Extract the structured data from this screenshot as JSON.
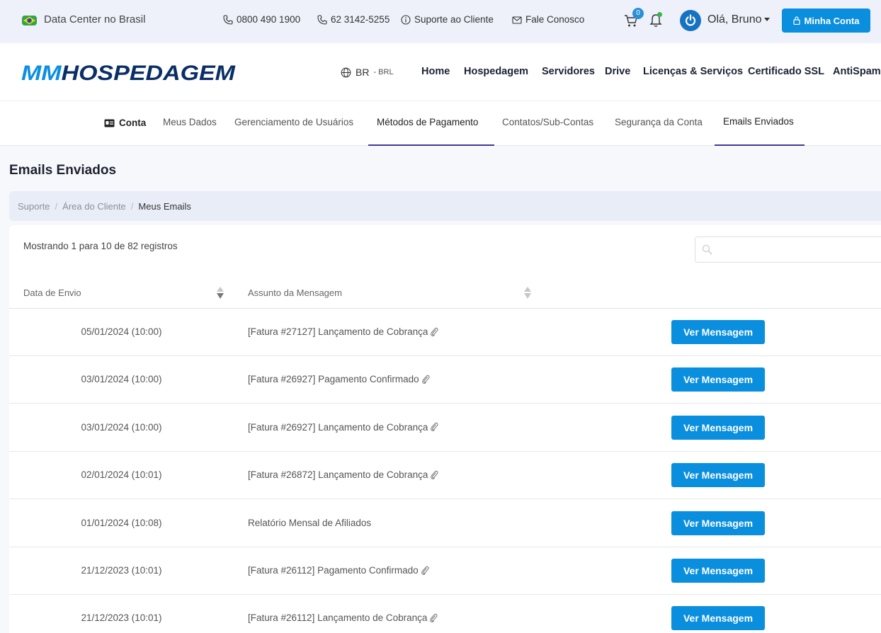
{
  "topbar": {
    "datacenter": "Data Center no Brasil",
    "phone1": "0800 490 1900",
    "phone2": "62 3142-5255",
    "support": "Suporte ao Cliente",
    "contact": "Fale Conosco",
    "cart_count": "0",
    "greeting": "Olá, Bruno",
    "account_button": "Minha Conta"
  },
  "logo": {
    "text": "MMHOSPEDAGEM",
    "color_mm": "#0b8fe0",
    "color_rest": "#0a2f66"
  },
  "lang": {
    "code": "BR",
    "currency": "- BRL"
  },
  "nav": [
    "Home",
    "Hospedagem",
    "Servidores",
    "Drive",
    "Licenças & Serviços",
    "Certificado SSL",
    "AntiSpam"
  ],
  "subnav": [
    "Conta",
    "Meus Dados",
    "Gerenciamento de Usuários",
    "Métodos de Pagamento",
    "Contatos/Sub-Contas",
    "Segurança da Conta",
    "Emails Enviados"
  ],
  "page_title": "Emails Enviados",
  "breadcrumb": [
    "Suporte",
    "/",
    "Área do Cliente",
    "/",
    "Meus Emails"
  ],
  "table": {
    "showing": "Mostrando 1 para 10 de 82 registros",
    "headers": {
      "date": "Data de Envio",
      "subject": "Assunto da Mensagem"
    },
    "button_label": "Ver Mensagem",
    "rows": [
      {
        "date": "05/01/2024 (10:00)",
        "subject": "[Fatura #27127] Lançamento de Cobrança",
        "attachment": true
      },
      {
        "date": "03/01/2024 (10:00)",
        "subject": "[Fatura #26927] Pagamento Confirmado",
        "attachment": true
      },
      {
        "date": "03/01/2024 (10:00)",
        "subject": "[Fatura #26927] Lançamento de Cobrança",
        "attachment": true
      },
      {
        "date": "02/01/2024 (10:01)",
        "subject": "[Fatura #26872] Lançamento de Cobrança",
        "attachment": true
      },
      {
        "date": "01/01/2024 (10:08)",
        "subject": "Relatório Mensal de Afiliados",
        "attachment": false
      },
      {
        "date": "21/12/2023 (10:01)",
        "subject": "[Fatura #26112] Pagamento Confirmado",
        "attachment": true
      },
      {
        "date": "21/12/2023 (10:01)",
        "subject": "[Fatura #26112] Lançamento de Cobrança",
        "attachment": true
      }
    ]
  },
  "colors": {
    "accent": "#0a8ede",
    "tab_underline": "#3d3b93"
  }
}
